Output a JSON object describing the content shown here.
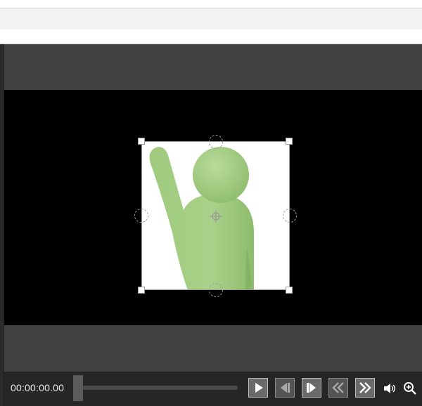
{
  "playback": {
    "time": "00:00:00.00",
    "progress": 0
  },
  "icons": {
    "play": "play-icon",
    "step_back": "step-back-icon",
    "step_forward": "step-forward-icon",
    "rewind": "rewind-icon",
    "fast_forward": "fast-forward-icon",
    "volume": "volume-icon",
    "zoom": "zoom-icon",
    "crosshair": "move-crosshair-icon"
  },
  "colors": {
    "figure_green": "#a5cf85",
    "stage_bg": "#000000",
    "viewport_bg": "#414141",
    "control_bar_bg": "#262626"
  }
}
